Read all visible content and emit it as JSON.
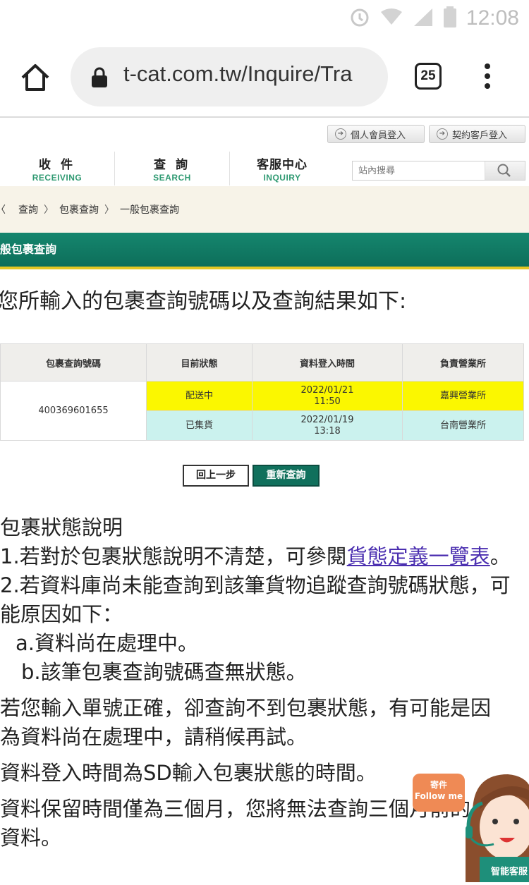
{
  "status_bar": {
    "time": "12:08"
  },
  "browser": {
    "url": "t-cat.com.tw/Inquire/Tra",
    "tab_count": "25"
  },
  "header": {
    "login_personal": "個人會員登入",
    "login_contract": "契約客戶登入",
    "nav": [
      {
        "zh": "收 件",
        "en": "RECEIVING"
      },
      {
        "zh": "查 詢",
        "en": "SEARCH"
      },
      {
        "zh": "客服中心",
        "en": "INQUIRY"
      }
    ],
    "search_placeholder": "站內搜尋"
  },
  "breadcrumb": [
    "〈",
    "查詢",
    "包裹查詢",
    "一般包裹查詢"
  ],
  "section_title": "般包裹查詢",
  "intro": "您所輸入的包裹查詢號碼以及查詢結果如下:",
  "table": {
    "headers": [
      "包裹查詢號碼",
      "目前狀態",
      "資料登入時間",
      "負責營業所"
    ],
    "tracking_number": "400369601655",
    "rows": [
      {
        "status": "配送中",
        "date": "2022/01/21",
        "time": "11:50",
        "office": "嘉興營業所"
      },
      {
        "status": "已集貨",
        "date": "2022/01/19",
        "time": "13:18",
        "office": "台南營業所"
      }
    ]
  },
  "buttons": {
    "back": "回上一步",
    "retry": "重新查詢"
  },
  "notes": {
    "title": "包裹狀態說明",
    "line1_pre": "1.若對於包裹狀態說明不清楚，可參閱",
    "line1_link": "貨態定義一覽表",
    "line1_post": "。",
    "line2": "2.若資料庫尚未能查詢到該筆貨物追蹤查詢號碼狀態，可能原因如下：",
    "line2a": "a.資料尚在處理中。",
    "line2b": "b.該筆包裹查詢號碼查無狀態。",
    "line3": "若您輸入單號正確，卻查詢不到包裹狀態，有可能是因為資料尚在處理中，請稍候再試。",
    "line4": "資料登入時間為SD輸入包裹狀態的時間。",
    "line5": "資料保留時間僅為三個月，您將無法查詢三個月前的資料。"
  },
  "widget": {
    "follow_line1": "寄件",
    "follow_line2": "Follow me",
    "mascot_label": "智能客服"
  }
}
